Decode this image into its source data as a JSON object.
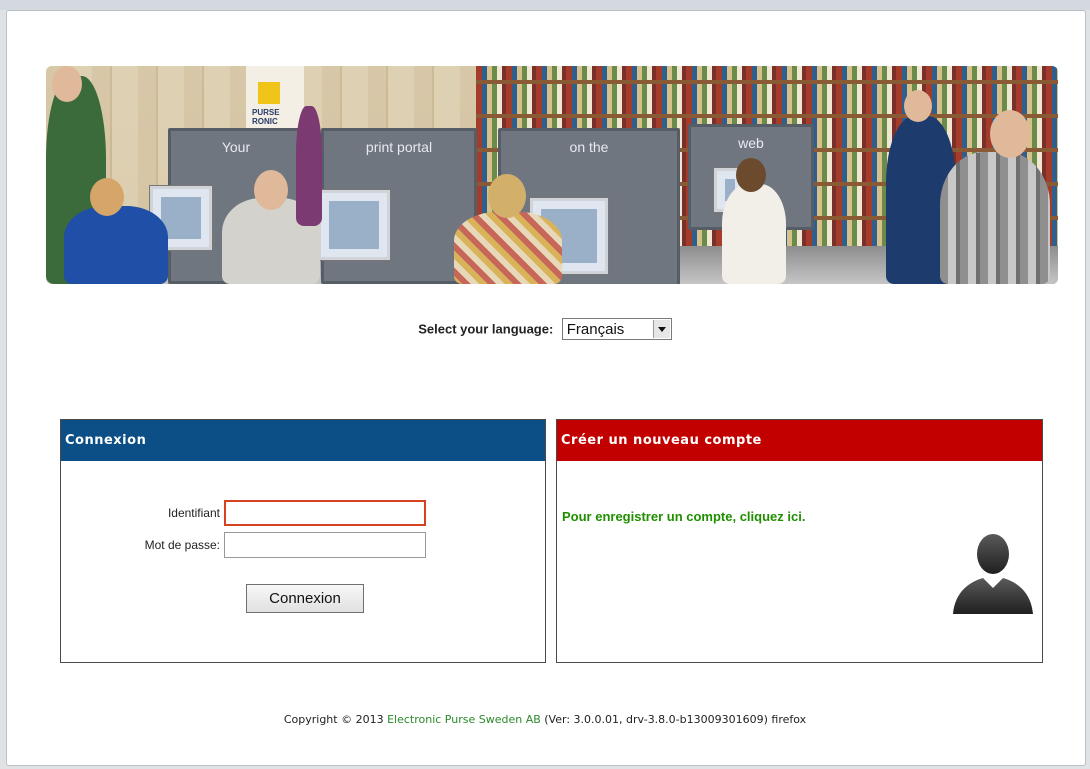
{
  "banner": {
    "captions": [
      "Your",
      "print portal",
      "on the",
      "web"
    ],
    "logo_text": "PURSE\nRONIC"
  },
  "language": {
    "label": "Select your language:",
    "selected": "Français"
  },
  "login": {
    "header": "Connexion",
    "username_label": "Identifiant",
    "password_label": "Mot de passe:",
    "button_label": "Connexion"
  },
  "register": {
    "header": "Créer un nouveau compte",
    "link_text": "Pour enregistrer un compte, cliquez ici."
  },
  "footer": {
    "prefix": "Copyright © 2013 ",
    "company": "Electronic Purse Sweden AB",
    "suffix": " (Ver: 3.0.0.01, drv-3.8.0-b13009301609) firefox"
  },
  "colors": {
    "login_header": "#0b4f86",
    "register_header": "#c30000",
    "link_green": "#1f8f00",
    "focus_border": "#d6421f"
  },
  "icons": {
    "language_dropdown": "chevron-down-icon",
    "register": "user-silhouette-icon"
  }
}
